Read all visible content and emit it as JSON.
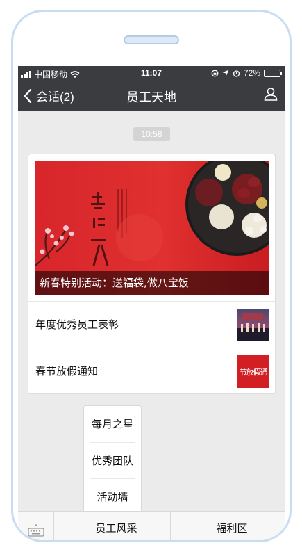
{
  "status_bar": {
    "carrier": "中国移动",
    "time": "11:07",
    "battery": "72%",
    "battery_level": 0.72
  },
  "nav": {
    "back_label": "会话(2)",
    "title": "员工天地"
  },
  "chat": {
    "timestamp": "10:58",
    "article": {
      "cover_caption": "新春特别活动：送福袋,做八宝饭",
      "items": [
        {
          "title": "年度优秀员工表彰"
        },
        {
          "title": "春节放假通知",
          "thumb_text": "节放假通"
        }
      ]
    }
  },
  "popup_menu": {
    "items": [
      "每月之星",
      "优秀团队",
      "活动墙"
    ]
  },
  "bottom_menu": {
    "buttons": [
      "员工风采",
      "福利区"
    ]
  },
  "colors": {
    "header_bg": "#3b3c3f",
    "chat_bg": "#ebebeb",
    "cover_red": "#d8262c",
    "frame": "#c9dcf2"
  }
}
